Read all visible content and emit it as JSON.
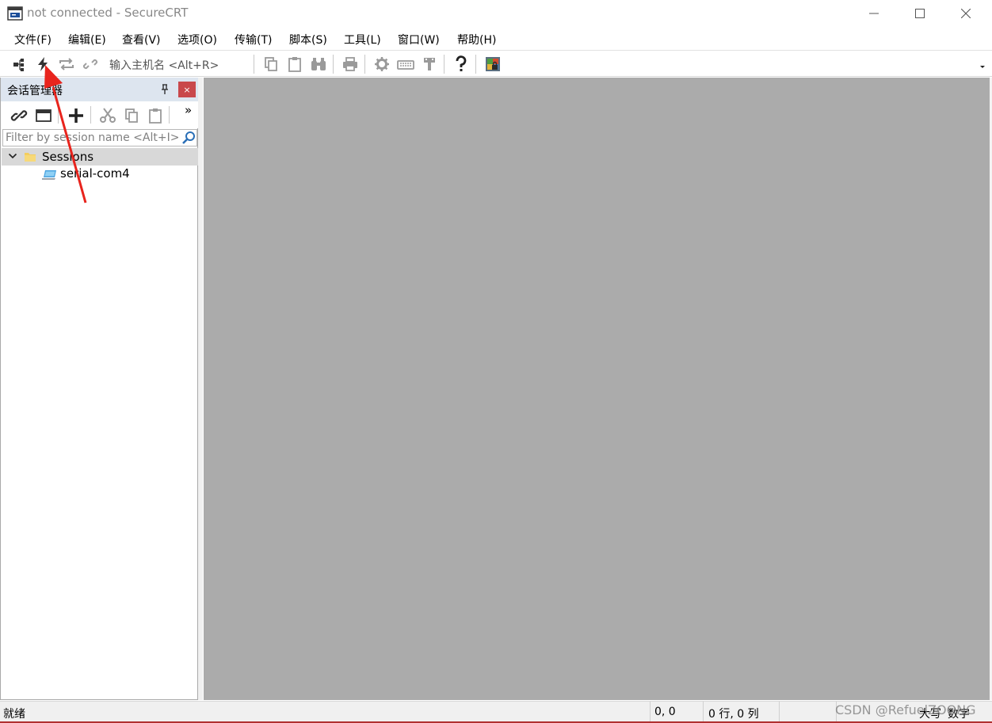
{
  "window": {
    "title": "not connected - SecureCRT"
  },
  "menu": {
    "items": [
      {
        "label": "文件(F)"
      },
      {
        "label": "编辑(E)"
      },
      {
        "label": "查看(V)"
      },
      {
        "label": "选项(O)"
      },
      {
        "label": "传输(T)"
      },
      {
        "label": "脚本(S)"
      },
      {
        "label": "工具(L)"
      },
      {
        "label": "窗口(W)"
      },
      {
        "label": "帮助(H)"
      }
    ]
  },
  "toolbar": {
    "host_placeholder": "输入主机名 <Alt+R>",
    "icons": [
      "connect-in-tab-icon",
      "quick-connect-icon",
      "reconnect-icon",
      "disconnect-icon",
      "copy-icon",
      "paste-icon",
      "find-icon",
      "print-icon",
      "session-options-icon",
      "keymap-icon",
      "sftp-icon",
      "help-icon",
      "secure-shell-icon"
    ]
  },
  "session_manager": {
    "title": "会话管理器",
    "filter_placeholder": "Filter by session name <Alt+I>",
    "more": "»",
    "close": "×",
    "tree": {
      "root": "Sessions",
      "children": [
        "serial-com4"
      ]
    }
  },
  "statusbar": {
    "ready": "就绪",
    "position": "0, 0",
    "rows_cols": "0 行, 0 列",
    "caps": "大写",
    "num": "数字"
  },
  "watermark": "CSDN @RefuelZOONG",
  "colors": {
    "workarea": "#ababab",
    "panel_header": "#dde5ef",
    "close_button": "#c9484b",
    "annotation_arrow": "#e8241d"
  }
}
